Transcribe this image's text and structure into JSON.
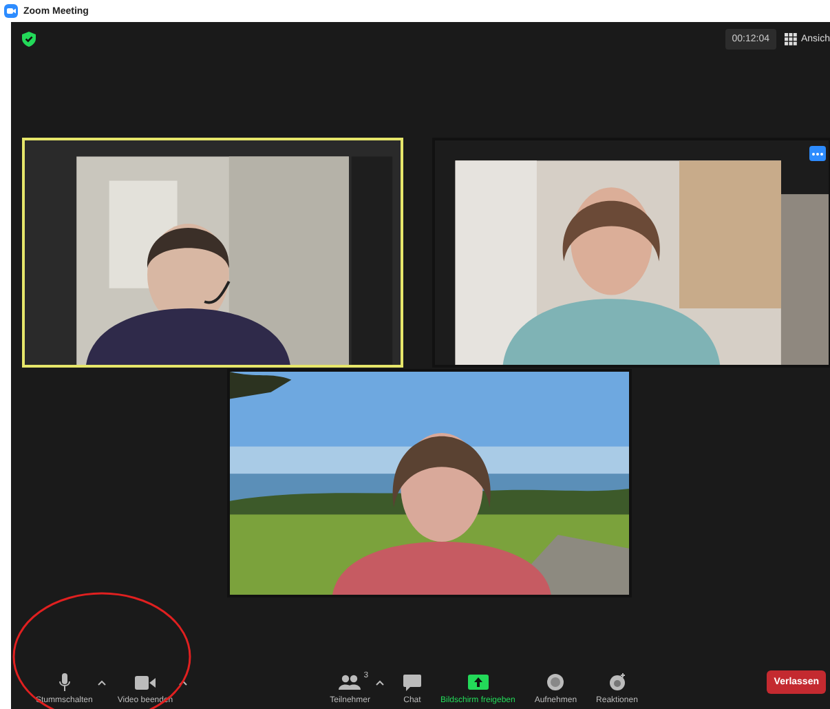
{
  "window": {
    "title": "Zoom Meeting"
  },
  "top_bar": {
    "timer": "00:12:04",
    "view_button": "Ansich"
  },
  "tiles": [
    {
      "kind": "office",
      "active_speaker": true
    },
    {
      "kind": "room",
      "active_speaker": false
    },
    {
      "kind": "landscape",
      "active_speaker": false
    }
  ],
  "toolbar": {
    "items": [
      {
        "kind": "mic",
        "label": "Stummschalten"
      },
      {
        "kind": "video",
        "label": "Video beenden"
      },
      {
        "kind": "participants",
        "label": "Teilnehmer",
        "count": "3"
      },
      {
        "kind": "chat",
        "label": "Chat"
      },
      {
        "kind": "share",
        "label": "Bildschirm freigeben"
      },
      {
        "kind": "record",
        "label": "Aufnehmen"
      },
      {
        "kind": "reactions",
        "label": "Reaktionen"
      }
    ],
    "leave_button": "Verlassen"
  }
}
